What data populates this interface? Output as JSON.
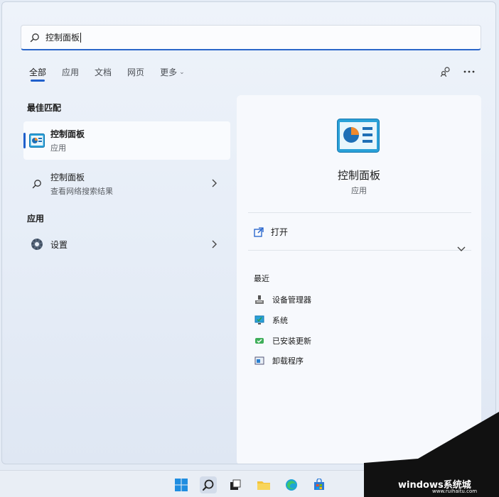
{
  "search": {
    "query": "控制面板"
  },
  "tabs": [
    {
      "label": "全部"
    },
    {
      "label": "应用"
    },
    {
      "label": "文档"
    },
    {
      "label": "网页"
    },
    {
      "label": "更多"
    }
  ],
  "sections": {
    "best_match": "最佳匹配",
    "apps": "应用"
  },
  "best_match": {
    "title": "控制面板",
    "subtitle": "应用"
  },
  "web_result": {
    "title": "控制面板",
    "subtitle": "查看网络搜索结果"
  },
  "apps_result": {
    "title": "设置"
  },
  "detail": {
    "title": "控制面板",
    "subtitle": "应用",
    "open_label": "打开",
    "recent_label": "最近",
    "recent_items": [
      {
        "label": "设备管理器",
        "icon": "device-manager-icon"
      },
      {
        "label": "系统",
        "icon": "system-icon"
      },
      {
        "label": "已安装更新",
        "icon": "installed-updates-icon"
      },
      {
        "label": "卸载程序",
        "icon": "uninstall-icon"
      }
    ]
  },
  "watermark": {
    "text": "windows系统城",
    "url": "www.ruihaitu.com"
  },
  "colors": {
    "accent": "#1f5fcb",
    "panel": "#f7f9fd",
    "background": "#e6edf7"
  }
}
